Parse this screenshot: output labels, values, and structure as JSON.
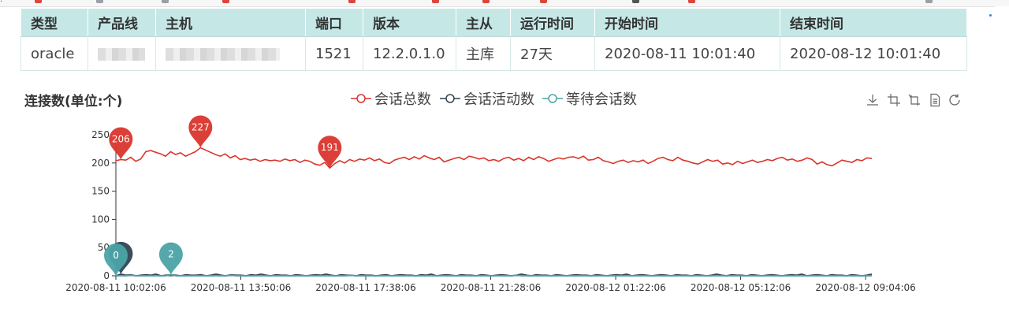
{
  "bookmarks": [
    "bookmarks-bar"
  ],
  "table": {
    "headers": [
      "类型",
      "产品线",
      "主机",
      "端口",
      "版本",
      "主从",
      "运行时间",
      "开始时间",
      "结束时间"
    ],
    "row": [
      "oracle",
      "",
      "",
      "1521",
      "12.2.0.1.0",
      "主库",
      "27天",
      "2020-08-11 10:01:40",
      "2020-08-12 10:01:40"
    ]
  },
  "chart_title": "连接数(单位:个)",
  "toolbox": [
    "download-icon",
    "zoom-icon",
    "zoom-reset-icon",
    "data-view-icon",
    "restore-icon"
  ],
  "colors": {
    "total": "#d9352c",
    "active": "#2f4554",
    "waiting": "#4ba3a6",
    "header_bg": "#c5e8e7"
  },
  "chart_data": {
    "type": "line",
    "title": "连接数(单位:个)",
    "x_ticks": [
      "2020-08-11 10:02:06",
      "2020-08-11 13:50:06",
      "2020-08-11 17:38:06",
      "2020-08-11 21:28:06",
      "2020-08-12 01:22:06",
      "2020-08-12 05:12:06",
      "2020-08-12 09:04:06"
    ],
    "ylim": [
      0,
      250
    ],
    "y_ticks": [
      0,
      50,
      100,
      150,
      200,
      250
    ],
    "series": [
      {
        "name": "会话总数",
        "values": [
          204,
          206,
          205,
          210,
          203,
          207,
          220,
          222,
          219,
          216,
          212,
          220,
          215,
          218,
          212,
          216,
          220,
          227,
          223,
          219,
          215,
          212,
          216,
          209,
          213,
          206,
          208,
          205,
          207,
          203,
          206,
          204,
          205,
          203,
          207,
          204,
          206,
          201,
          205,
          203,
          198,
          196,
          201,
          191,
          199,
          204,
          200,
          206,
          203,
          207,
          205,
          209,
          204,
          207,
          201,
          199,
          205,
          208,
          210,
          206,
          211,
          207,
          213,
          209,
          206,
          210,
          202,
          205,
          208,
          210,
          206,
          212,
          210,
          207,
          209,
          204,
          206,
          203,
          208,
          210,
          205,
          208,
          204,
          210,
          206,
          211,
          208,
          203,
          206,
          209,
          207,
          210,
          211,
          208,
          212,
          205,
          206,
          210,
          204,
          202,
          199,
          203,
          205,
          201,
          204,
          202,
          205,
          199,
          203,
          208,
          210,
          206,
          204,
          210,
          205,
          203,
          200,
          198,
          202,
          206,
          203,
          205,
          198,
          200,
          197,
          203,
          199,
          202,
          205,
          201,
          203,
          206,
          204,
          208,
          210,
          205,
          207,
          203,
          205,
          209,
          206,
          198,
          202,
          197,
          195,
          200,
          205,
          203,
          201,
          206,
          204,
          209,
          208
        ]
      },
      {
        "name": "会话活动数",
        "values": [
          0,
          3,
          1,
          2,
          0,
          1,
          2,
          1,
          3,
          0,
          1,
          2,
          1,
          0,
          2,
          1,
          1,
          2,
          0,
          1,
          3,
          1,
          0,
          2,
          1,
          1,
          0,
          2,
          1,
          3,
          1,
          0,
          2,
          1,
          1,
          0,
          2,
          1,
          0,
          1,
          2,
          1,
          3,
          1,
          0,
          2,
          1,
          1,
          0,
          2,
          1,
          1,
          0,
          1,
          2,
          0,
          1,
          2,
          1,
          1,
          0,
          2,
          1,
          3,
          0,
          1,
          2,
          1,
          0,
          2,
          1,
          1,
          0,
          2,
          1,
          0,
          1,
          2,
          1,
          0,
          1,
          3,
          1,
          0,
          2,
          1,
          1,
          0,
          2,
          1,
          0,
          1,
          2,
          1,
          1,
          0,
          2,
          1,
          0,
          1,
          2,
          1,
          3,
          0,
          1,
          2,
          1,
          0,
          1,
          2,
          1,
          0,
          2,
          1,
          1,
          0,
          2,
          1,
          0,
          1,
          3,
          1,
          0,
          2,
          1,
          1,
          0,
          2,
          1,
          0,
          1,
          2,
          1,
          0,
          1,
          2,
          1,
          3,
          0,
          1,
          2,
          1,
          0,
          2,
          1,
          1,
          0,
          2,
          1,
          0,
          1,
          3
        ]
      },
      {
        "name": "等待会话数",
        "values": [
          0,
          0,
          0,
          1,
          0,
          0,
          0,
          0,
          0,
          0,
          0,
          2,
          0,
          0,
          0,
          0,
          0,
          0,
          0,
          0,
          0,
          0,
          0,
          1,
          0,
          0,
          0,
          0,
          0,
          0,
          0,
          0,
          0,
          0,
          0,
          0,
          0,
          0,
          0,
          0,
          0,
          0,
          0,
          0,
          0,
          0,
          0,
          1,
          0,
          0,
          0,
          0,
          0,
          0,
          0,
          0,
          0,
          0,
          0,
          0,
          0,
          0,
          0,
          0,
          0,
          0,
          0,
          0,
          0,
          0,
          0,
          0,
          0,
          0,
          0,
          0,
          0,
          0,
          0,
          0,
          1,
          0,
          0,
          0,
          0,
          0,
          0,
          0,
          0,
          0,
          0,
          0,
          0,
          0,
          0,
          0,
          0,
          0,
          0,
          0,
          0,
          0,
          0,
          0,
          0,
          0,
          0,
          0,
          0,
          0,
          0,
          0,
          0,
          0,
          0,
          0,
          0,
          0,
          0,
          0,
          0,
          0,
          0,
          0,
          0,
          0,
          0,
          0,
          0,
          0,
          0,
          0,
          0,
          0,
          0,
          0,
          0,
          0,
          0,
          0,
          0,
          0,
          0,
          0,
          0,
          0,
          0,
          0,
          0,
          0,
          0,
          0
        ]
      }
    ],
    "mark_points": [
      {
        "series": "会话总数",
        "label": "206",
        "index": 1,
        "kind": "max"
      },
      {
        "series": "会话总数",
        "label": "227",
        "index": 17,
        "kind": "max"
      },
      {
        "series": "会话总数",
        "label": "191",
        "index": 43,
        "kind": "min"
      },
      {
        "series": "会话活动数",
        "label": "",
        "index": 1,
        "kind": "max"
      },
      {
        "series": "等待会话数",
        "label": "0",
        "index": 0,
        "kind": "min"
      },
      {
        "series": "等待会话数",
        "label": "2",
        "index": 11,
        "kind": "max"
      }
    ],
    "legend_position": "top-center",
    "grid": false
  }
}
